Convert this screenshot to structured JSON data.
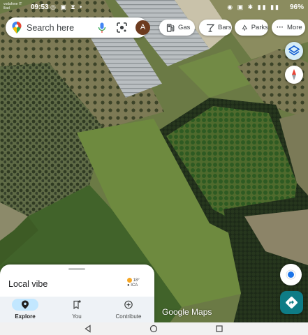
{
  "status_bar": {
    "carrier": "vodafone IT\nlliad",
    "time": "09:53",
    "left_icons": "◎ ▣ ⧗ •",
    "right_icons": "◉ ▣ ✱ ▮▮ ▮▮",
    "battery": "96%"
  },
  "search": {
    "placeholder": "Search here",
    "avatar_letter": "A",
    "pin_icon": "maps-pin-icon",
    "mic_icon": "mic-icon",
    "lens_icon": "lens-icon"
  },
  "chips": [
    {
      "label": "Gas",
      "icon": "gas-station-icon"
    },
    {
      "label": "Bars",
      "icon": "cocktail-icon"
    },
    {
      "label": "Parks",
      "icon": "tree-icon"
    },
    {
      "label": "More",
      "icon": "more-dots-icon",
      "glyph": "···"
    }
  ],
  "map": {
    "watermark_brand": "Google",
    "watermark_product": "Maps"
  },
  "sheet": {
    "title": "Local vibe",
    "weather_temp": "18°",
    "weather_aqi": "● ICA"
  },
  "nav": {
    "items": [
      {
        "label": "Explore",
        "icon": "explore-pin-icon",
        "active": true
      },
      {
        "label": "You",
        "icon": "bookmark-icon",
        "active": false
      },
      {
        "label": "Contribute",
        "icon": "add-circle-icon",
        "active": false
      }
    ]
  },
  "colors": {
    "accent": "#c2e7ff",
    "directions": "#0e7c86",
    "location": "#1a73e8",
    "compass_red": "#ea4335"
  }
}
